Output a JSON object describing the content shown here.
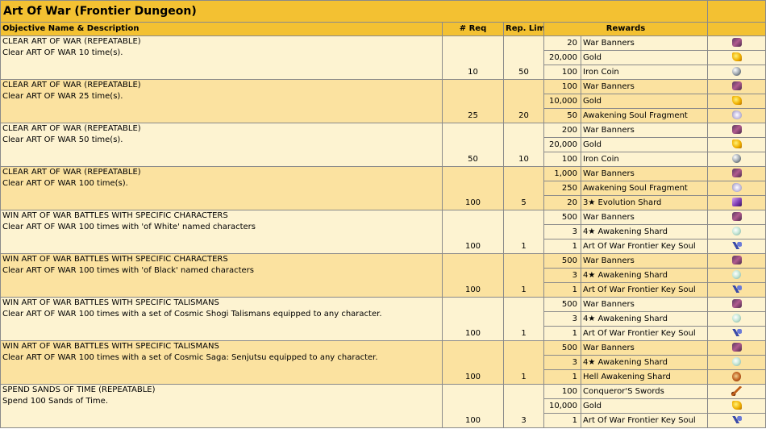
{
  "title": "Art Of War (Frontier Dungeon)",
  "headers": {
    "objective": "Objective Name & Description",
    "req": "# Req",
    "limit": "Rep. Limit",
    "rewards": "Rewards"
  },
  "rows": [
    {
      "name": "CLEAR ART OF WAR (REPEATABLE)",
      "desc": "Clear ART OF WAR 10 time(s).",
      "req": "10",
      "limit": "50",
      "rewards": [
        {
          "qty": "20",
          "item": "War Banners",
          "icon": "war-banners-icon"
        },
        {
          "qty": "20,000",
          "item": "Gold",
          "icon": "gold-icon"
        },
        {
          "qty": "100",
          "item": "Iron Coin",
          "icon": "iron-coin-icon"
        }
      ]
    },
    {
      "name": "CLEAR ART OF WAR (REPEATABLE)",
      "desc": "Clear ART OF WAR 25 time(s).",
      "req": "25",
      "limit": "20",
      "rewards": [
        {
          "qty": "100",
          "item": "War Banners",
          "icon": "war-banners-icon"
        },
        {
          "qty": "10,000",
          "item": "Gold",
          "icon": "gold-icon"
        },
        {
          "qty": "50",
          "item": "Awakening Soul Fragment",
          "icon": "soul-fragment-icon"
        }
      ]
    },
    {
      "name": "CLEAR ART OF WAR (REPEATABLE)",
      "desc": "Clear ART OF WAR 50 time(s).",
      "req": "50",
      "limit": "10",
      "rewards": [
        {
          "qty": "200",
          "item": "War Banners",
          "icon": "war-banners-icon"
        },
        {
          "qty": "20,000",
          "item": "Gold",
          "icon": "gold-icon"
        },
        {
          "qty": "100",
          "item": "Iron Coin",
          "icon": "iron-coin-icon"
        }
      ]
    },
    {
      "name": "CLEAR ART OF WAR (REPEATABLE)",
      "desc": "Clear ART OF WAR 100 time(s).",
      "req": "100",
      "limit": "5",
      "rewards": [
        {
          "qty": "1,000",
          "item": "War Banners",
          "icon": "war-banners-icon"
        },
        {
          "qty": "250",
          "item": "Awakening Soul Fragment",
          "icon": "soul-fragment-icon"
        },
        {
          "qty": "20",
          "item": "3★ Evolution Shard",
          "icon": "evolution-shard-icon"
        }
      ]
    },
    {
      "name": "WIN ART OF WAR BATTLES WITH SPECIFIC CHARACTERS",
      "desc": "Clear ART OF WAR 100 times with 'of White' named characters",
      "req": "100",
      "limit": "1",
      "rewards": [
        {
          "qty": "500",
          "item": "War Banners",
          "icon": "war-banners-icon"
        },
        {
          "qty": "3",
          "item": "4★ Awakening Shard",
          "icon": "awakening-shard-icon"
        },
        {
          "qty": "1",
          "item": "Art Of War Frontier Key Soul",
          "icon": "key-soul-icon"
        }
      ]
    },
    {
      "name": "WIN ART OF WAR BATTLES WITH SPECIFIC CHARACTERS",
      "desc": "Clear ART OF WAR 100 times with 'of Black' named characters",
      "req": "100",
      "limit": "1",
      "rewards": [
        {
          "qty": "500",
          "item": "War Banners",
          "icon": "war-banners-icon"
        },
        {
          "qty": "3",
          "item": "4★ Awakening Shard",
          "icon": "awakening-shard-icon"
        },
        {
          "qty": "1",
          "item": "Art Of War Frontier Key Soul",
          "icon": "key-soul-icon"
        }
      ]
    },
    {
      "name": "WIN ART OF WAR BATTLES WITH SPECIFIC TALISMANS",
      "desc": "Clear ART OF WAR 100 times with a set of Cosmic Shogi Talismans equipped to any character.",
      "req": "100",
      "limit": "1",
      "rewards": [
        {
          "qty": "500",
          "item": "War Banners",
          "icon": "war-banners-icon"
        },
        {
          "qty": "3",
          "item": "4★ Awakening Shard",
          "icon": "awakening-shard-icon"
        },
        {
          "qty": "1",
          "item": "Art Of War Frontier Key Soul",
          "icon": "key-soul-icon"
        }
      ]
    },
    {
      "name": "WIN ART OF WAR BATTLES WITH SPECIFIC TALISMANS",
      "desc": "Clear ART OF WAR 100 times with a set of Cosmic Saga: Senjutsu equipped to any character.",
      "req": "100",
      "limit": "1",
      "rewards": [
        {
          "qty": "500",
          "item": "War Banners",
          "icon": "war-banners-icon"
        },
        {
          "qty": "3",
          "item": "4★ Awakening Shard",
          "icon": "awakening-shard-icon"
        },
        {
          "qty": "1",
          "item": "Hell Awakening Shard",
          "icon": "hell-awakening-shard-icon"
        }
      ]
    },
    {
      "name": "SPEND SANDS OF TIME (REPEATABLE)",
      "desc": "Spend 100 Sands of Time.",
      "req": "100",
      "limit": "3",
      "rewards": [
        {
          "qty": "100",
          "item": "Conqueror'S Swords",
          "icon": "conquerors-swords-icon"
        },
        {
          "qty": "10,000",
          "item": "Gold",
          "icon": "gold-icon"
        },
        {
          "qty": "1",
          "item": "Art Of War Frontier Key Soul",
          "icon": "key-soul-icon"
        }
      ]
    }
  ]
}
